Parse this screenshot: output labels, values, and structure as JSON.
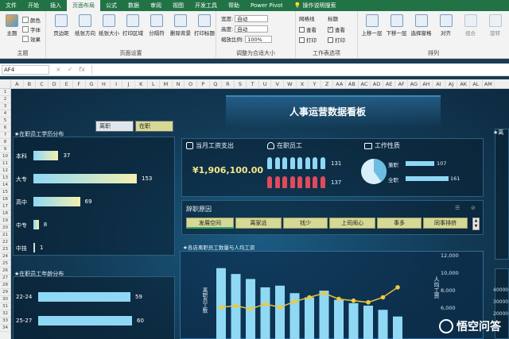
{
  "ribbon_tabs": [
    "文件",
    "开始",
    "插入",
    "页面布局",
    "公式",
    "数据",
    "审阅",
    "视图",
    "开发工具",
    "帮助",
    "Power Pivot",
    "操作说明搜索"
  ],
  "active_tab_index": 3,
  "ribbon": {
    "theme": {
      "big": "主题",
      "items": [
        "颜色",
        "字体",
        "效果"
      ],
      "group": "主题"
    },
    "page_setup": {
      "buttons": [
        "页边距",
        "纸张方向",
        "纸张大小",
        "打印区域",
        "分隔符",
        "删除背景",
        "打印标题"
      ],
      "group": "页面设置"
    },
    "scale": {
      "width_label": "宽度:",
      "width_val": "自动",
      "height_label": "高度:",
      "height_val": "自动",
      "scale_label": "缩放比例:",
      "scale_val": "100%",
      "group": "调整为合适大小"
    },
    "sheet_opts": {
      "grid": "网格线",
      "heading": "标题",
      "view": "查看",
      "print": "打印",
      "grid_view": false,
      "heading_view": true,
      "grid_print": false,
      "heading_print": false,
      "group": "工作表选项"
    },
    "arrange": {
      "buttons": [
        "上移一层",
        "下移一层",
        "选择窗格",
        "对齐",
        "组合",
        "旋转"
      ],
      "group": "排列"
    }
  },
  "formula_bar": {
    "name_box": "AF4",
    "icons": [
      "×",
      "✓",
      "fx"
    ],
    "value": ""
  },
  "columns": [
    "A",
    "B",
    "C",
    "D",
    "E",
    "F",
    "G",
    "H",
    "I",
    "J",
    "K",
    "L",
    "M",
    "N",
    "O",
    "P",
    "Q",
    "R",
    "S",
    "T",
    "U",
    "V",
    "W",
    "X",
    "Y",
    "Z",
    "AA",
    "AB",
    "AC",
    "AD",
    "AE",
    "AF",
    "AG",
    "AH",
    "AI",
    "AJ",
    "AK",
    "AL",
    "AM"
  ],
  "rows": [
    "1",
    "2",
    "3",
    "4",
    "5",
    "6",
    "7",
    "8",
    "9",
    "10",
    "11",
    "12",
    "13",
    "14",
    "15",
    "16",
    "17",
    "18",
    "19",
    "20",
    "21",
    "22",
    "23",
    "24",
    "25",
    "26",
    "27",
    "28",
    "29",
    "30",
    "31",
    "32",
    "33",
    "34"
  ],
  "dashboard": {
    "title": "人事运营数据看板",
    "slicer": {
      "left": "离职",
      "right": "在职"
    },
    "education": {
      "title": "在职员工学历分布",
      "items": [
        {
          "label": "本科",
          "value": 37
        },
        {
          "label": "大专",
          "value": 153
        },
        {
          "label": "高中",
          "value": 69
        },
        {
          "label": "中专",
          "value": 8
        },
        {
          "label": "中技",
          "value": 1
        }
      ]
    },
    "age": {
      "title": "在职员工年龄分布",
      "items": [
        {
          "label": "22-24",
          "value": 59
        },
        {
          "label": "25-27",
          "value": 60
        }
      ]
    },
    "kpi": {
      "salary_title": "当月工资支出",
      "salary_value": "¥1,906,100.00",
      "staff_title": "在职员工",
      "staff_top": "131",
      "staff_bottom": "137",
      "nature_title": "工作性质",
      "parttime_label": "兼职",
      "parttime_value": "107",
      "fulltime_label": "全职",
      "fulltime_value": "161"
    },
    "reasons": {
      "title": "辞职原因",
      "items": [
        "发展空间",
        "离家远",
        "钱少",
        "上司闹心",
        "事多",
        "同事排挤"
      ]
    },
    "store": {
      "title": "各店离职员工数量与人均工资",
      "left_axis_label": "离职员工数",
      "right_axis_label": "人均工资",
      "right_ticks": [
        "12,000",
        "10,000",
        "8,000",
        "6,000"
      ],
      "bars": [
        0.85,
        0.78,
        0.72,
        0.62,
        0.64,
        0.55,
        0.5,
        0.58,
        0.47,
        0.43,
        0.4,
        0.35,
        0.27
      ],
      "line": [
        0.38,
        0.4,
        0.36,
        0.42,
        0.38,
        0.45,
        0.5,
        0.55,
        0.48,
        0.46,
        0.44,
        0.5,
        0.62
      ]
    },
    "right_panel": {
      "title": "离",
      "ticks": [
        "40000",
        "30000",
        "20000"
      ]
    },
    "watermark": "悟空问答"
  }
}
